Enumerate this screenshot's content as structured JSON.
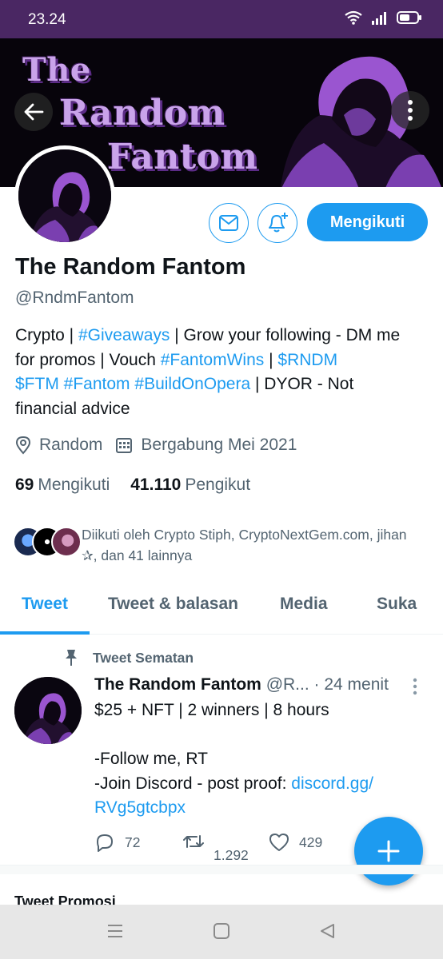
{
  "status_bar": {
    "time": "23.24"
  },
  "banner": {
    "line1": "The",
    "line2": "Random",
    "line3": "Fantom"
  },
  "header": {
    "back_icon": "arrow-left-icon",
    "more_icon": "more-vertical-icon"
  },
  "actions": {
    "follow_label": "Mengikuti"
  },
  "profile": {
    "name": "The Random Fantom",
    "handle": "@RndmFantom",
    "bio": {
      "p1": "Crypto | ",
      "t1": "#Giveaways",
      "p2": " | Grow your following - DM me for promos | Vouch ",
      "t2": "#FantomWins",
      "p3": " | ",
      "t3": "$RNDM",
      "p4": " ",
      "t4": "$FTM",
      "p5": " ",
      "t5": "#Fantom",
      "p6": " ",
      "t6": "#BuildOnOpera",
      "p7": " | DYOR - Not financial advice"
    },
    "location": "Random",
    "joined": "Bergabung Mei 2021",
    "following_count": "69",
    "following_label": "Mengikuti",
    "followers_count": "41.110",
    "followers_label": "Pengikut",
    "followed_by": "Diikuti oleh Crypto Stiph, CryptoNextGem.com, jihan ✰, dan 41 lainnya"
  },
  "tabs": [
    {
      "label": "Tweet",
      "active": true
    },
    {
      "label": "Tweet & balasan",
      "active": false
    },
    {
      "label": "Media",
      "active": false
    },
    {
      "label": "Suka",
      "active": false
    }
  ],
  "pinned_tweet": {
    "pinned_label": "Tweet Sematan",
    "name": "The Random Fantom",
    "handle": "@R...",
    "time": "· 24 menit",
    "line1": "$25 + NFT | 2 winners | 8 hours",
    "line2": "-Follow me, RT",
    "line3": "-Join Discord - post proof: ",
    "link1": "discord.gg/",
    "link2": "RVg5gtcbpx",
    "replies": "72",
    "retweets": "1.292",
    "likes": "429"
  },
  "promo": {
    "title": "Tweet Promosi"
  },
  "colors": {
    "accent": "#1d9bf0",
    "status_bar": "#4a2763",
    "banner_text": "#c9a3ea"
  }
}
